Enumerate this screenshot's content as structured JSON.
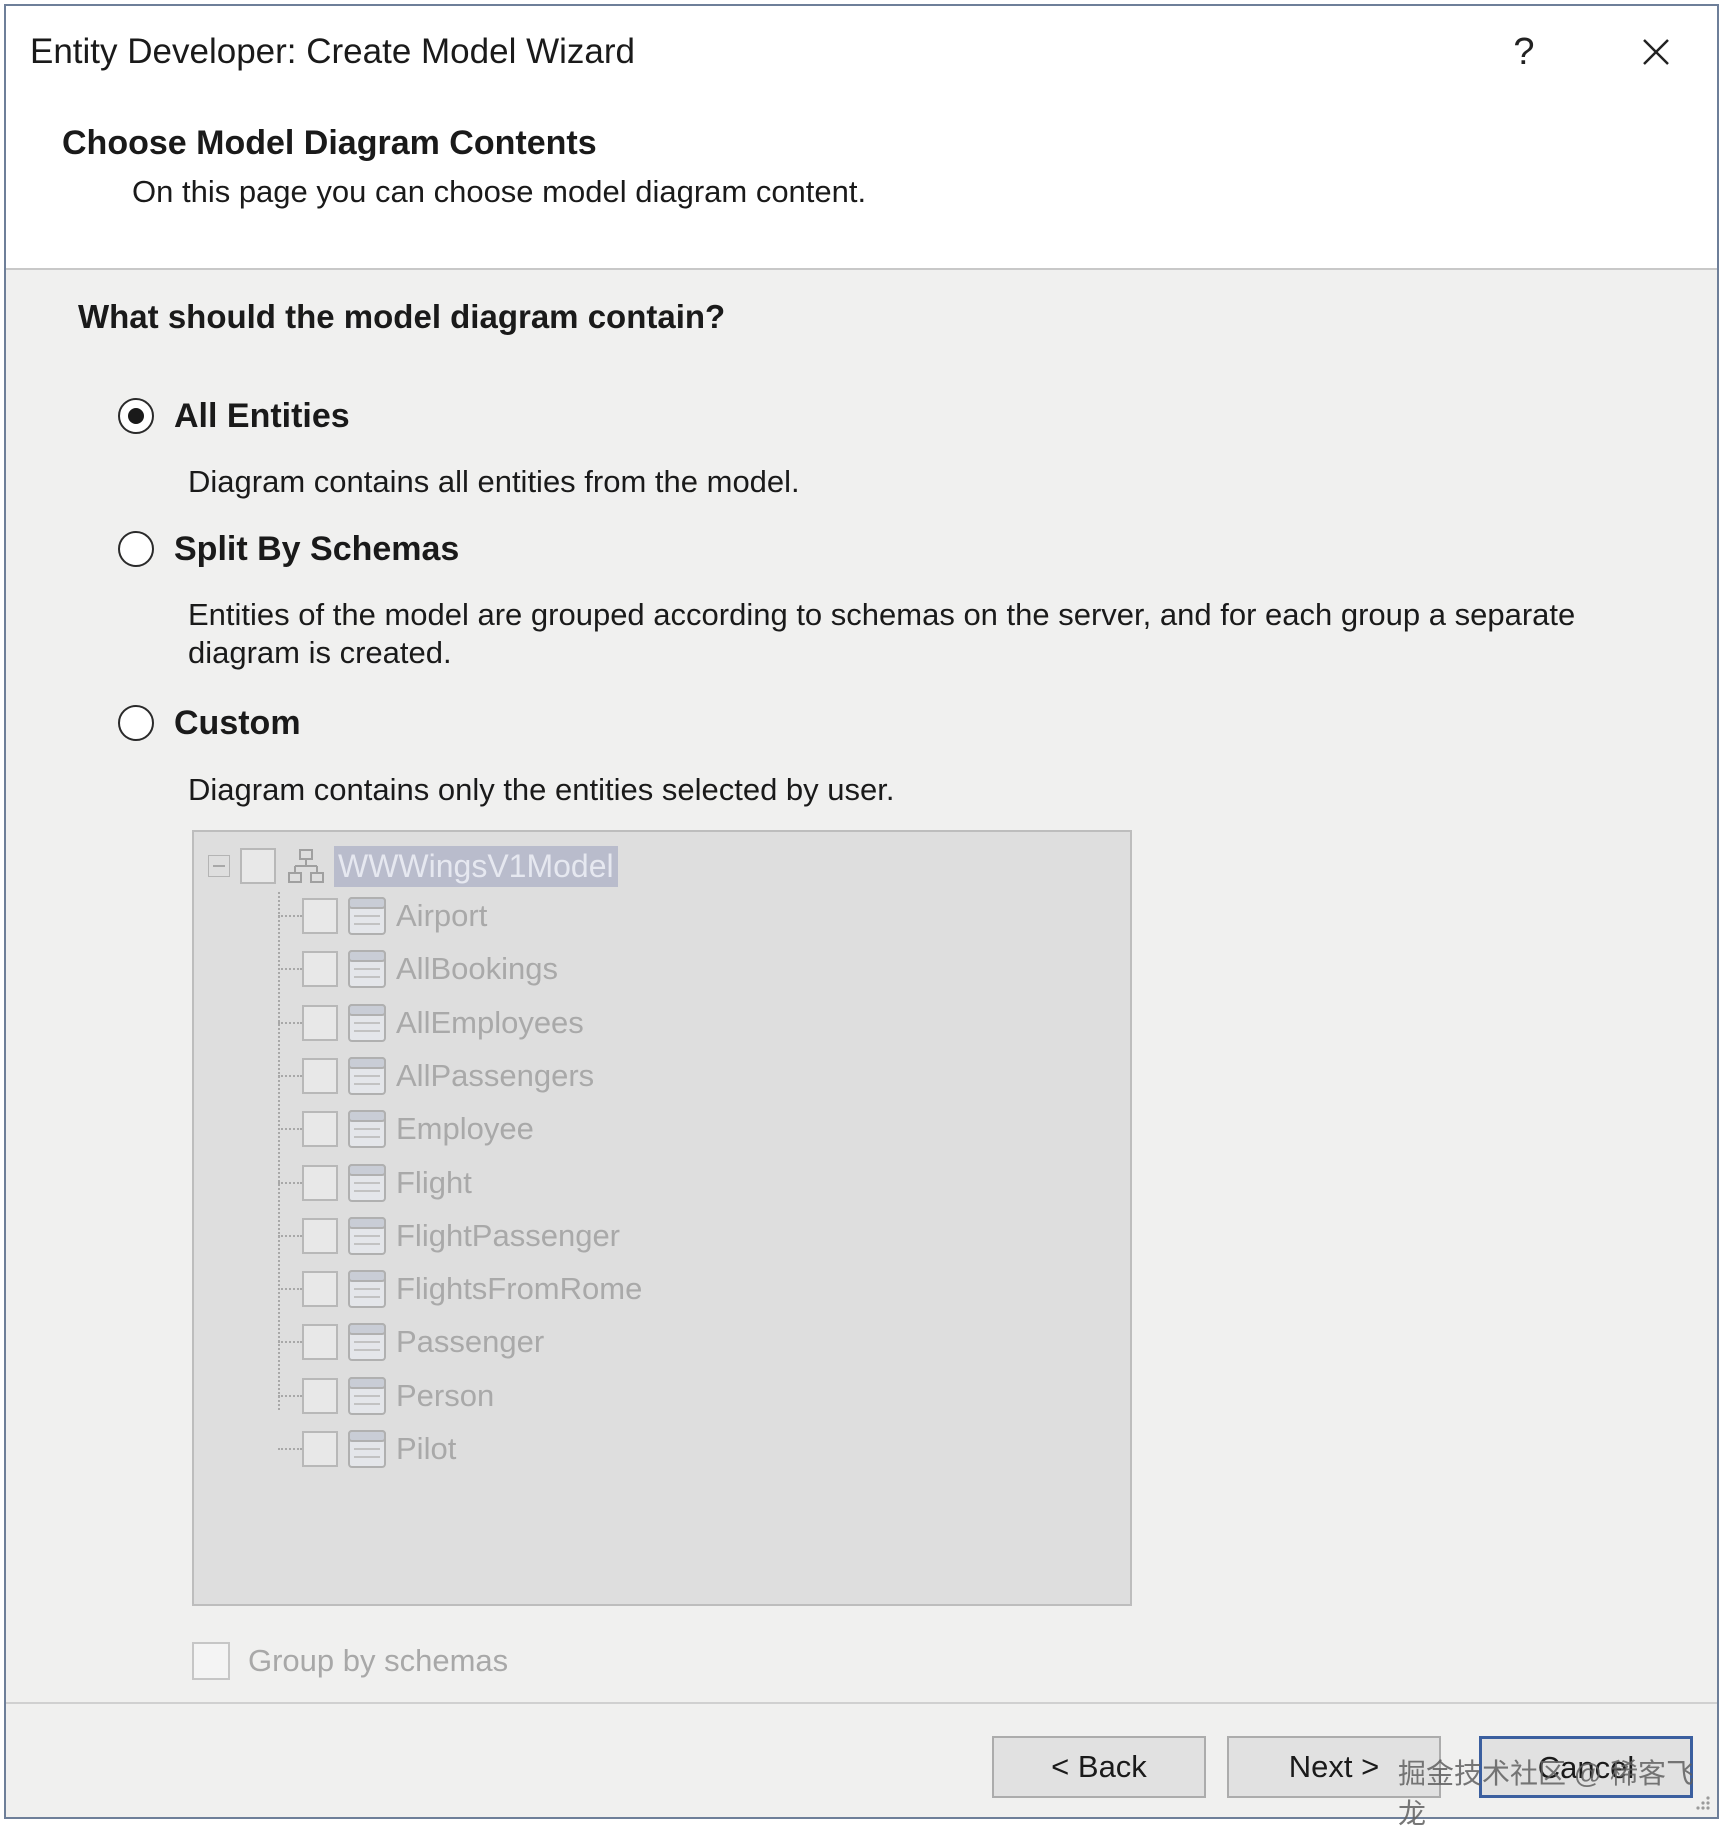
{
  "window": {
    "title": "Entity Developer: Create Model Wizard",
    "help_label": "?"
  },
  "header": {
    "title": "Choose Model Diagram Contents",
    "subtitle": "On this page you can choose model diagram content."
  },
  "question": "What should the model diagram contain?",
  "options": [
    {
      "label": "All Entities",
      "description": "Diagram contains all entities from the model.",
      "checked": true
    },
    {
      "label": "Split By Schemas",
      "description": "Entities of the model are grouped according to schemas on the server, and for each group a separate diagram is created.",
      "checked": false
    },
    {
      "label": "Custom",
      "description": "Diagram contains only the entities selected by user.",
      "checked": false
    }
  ],
  "tree": {
    "root": "WWWingsV1Model",
    "items": [
      "Airport",
      "AllBookings",
      "AllEmployees",
      "AllPassengers",
      "Employee",
      "Flight",
      "FlightPassenger",
      "FlightsFromRome",
      "Passenger",
      "Person",
      "Pilot"
    ]
  },
  "group_by_schemas_label": "Group by schemas",
  "buttons": {
    "back": "< Back",
    "next": "Next >",
    "cancel": "Cancel"
  },
  "watermark": "掘金技术社区 @ 稀客飞龙",
  "colors": {
    "window_border": "#6e7f99",
    "tree_background": "#dedede",
    "root_highlight": "#b9bccc",
    "primary_button_border": "#3b5f9f"
  }
}
